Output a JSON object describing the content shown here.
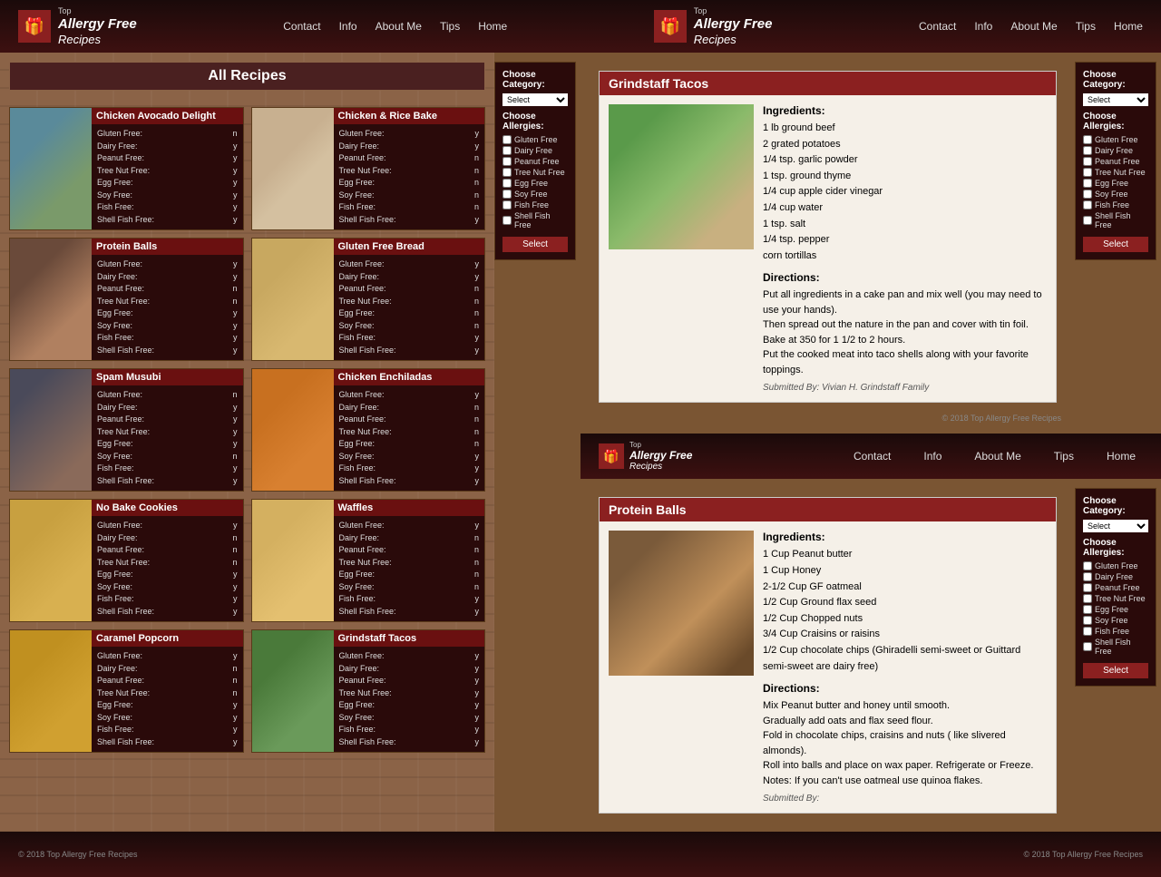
{
  "site": {
    "name_top": "Top",
    "name_main": "Allergy Free",
    "name_sub": "Recipes",
    "copyright": "© 2018 Top Allergy Free Recipes"
  },
  "nav": {
    "contact": "Contact",
    "info": "Info",
    "about": "About Me",
    "tips": "Tips",
    "home": "Home"
  },
  "left_panel": {
    "title": "All Recipes",
    "recipes": [
      {
        "name": "Chicken Avocado Delight",
        "img_class": "img-chicken-avocado",
        "allergies": [
          {
            "label": "Gluten Free:",
            "val": "n"
          },
          {
            "label": "Dairy Free:",
            "val": "y"
          },
          {
            "label": "Peanut Free:",
            "val": "y"
          },
          {
            "label": "Tree Nut Free:",
            "val": "y"
          },
          {
            "label": "Egg Free:",
            "val": "y"
          },
          {
            "label": "Soy Free:",
            "val": "y"
          },
          {
            "label": "Fish Free:",
            "val": "y"
          },
          {
            "label": "Shell Fish Free:",
            "val": "y"
          }
        ]
      },
      {
        "name": "Chicken & Rice Bake",
        "img_class": "img-chicken-rice",
        "allergies": [
          {
            "label": "Gluten Free:",
            "val": "y"
          },
          {
            "label": "Dairy Free:",
            "val": "y"
          },
          {
            "label": "Peanut Free:",
            "val": "n"
          },
          {
            "label": "Tree Nut Free:",
            "val": "n"
          },
          {
            "label": "Egg Free:",
            "val": "n"
          },
          {
            "label": "Soy Free:",
            "val": "n"
          },
          {
            "label": "Fish Free:",
            "val": "n"
          },
          {
            "label": "Shell Fish Free:",
            "val": "y"
          }
        ]
      },
      {
        "name": "Protein Balls",
        "img_class": "img-protein-balls",
        "allergies": [
          {
            "label": "Gluten Free:",
            "val": "y"
          },
          {
            "label": "Dairy Free:",
            "val": "y"
          },
          {
            "label": "Peanut Free:",
            "val": "n"
          },
          {
            "label": "Tree Nut Free:",
            "val": "n"
          },
          {
            "label": "Egg Free:",
            "val": "y"
          },
          {
            "label": "Soy Free:",
            "val": "y"
          },
          {
            "label": "Fish Free:",
            "val": "y"
          },
          {
            "label": "Shell Fish Free:",
            "val": "y"
          }
        ]
      },
      {
        "name": "Gluten Free Bread",
        "img_class": "img-gluten-bread",
        "allergies": [
          {
            "label": "Gluten Free:",
            "val": "y"
          },
          {
            "label": "Dairy Free:",
            "val": "y"
          },
          {
            "label": "Peanut Free:",
            "val": "n"
          },
          {
            "label": "Tree Nut Free:",
            "val": "n"
          },
          {
            "label": "Egg Free:",
            "val": "n"
          },
          {
            "label": "Soy Free:",
            "val": "n"
          },
          {
            "label": "Fish Free:",
            "val": "y"
          },
          {
            "label": "Shell Fish Free:",
            "val": "y"
          }
        ]
      },
      {
        "name": "Spam Musubi",
        "img_class": "img-spam",
        "allergies": [
          {
            "label": "Gluten Free:",
            "val": "n"
          },
          {
            "label": "Dairy Free:",
            "val": "y"
          },
          {
            "label": "Peanut Free:",
            "val": "y"
          },
          {
            "label": "Tree Nut Free:",
            "val": "y"
          },
          {
            "label": "Egg Free:",
            "val": "y"
          },
          {
            "label": "Soy Free:",
            "val": "n"
          },
          {
            "label": "Fish Free:",
            "val": "y"
          },
          {
            "label": "Shell Fish Free:",
            "val": "y"
          }
        ]
      },
      {
        "name": "Chicken Enchiladas",
        "img_class": "img-enchiladas",
        "allergies": [
          {
            "label": "Gluten Free:",
            "val": "y"
          },
          {
            "label": "Dairy Free:",
            "val": "n"
          },
          {
            "label": "Peanut Free:",
            "val": "n"
          },
          {
            "label": "Tree Nut Free:",
            "val": "n"
          },
          {
            "label": "Egg Free:",
            "val": "n"
          },
          {
            "label": "Soy Free:",
            "val": "y"
          },
          {
            "label": "Fish Free:",
            "val": "y"
          },
          {
            "label": "Shell Fish Free:",
            "val": "y"
          }
        ]
      },
      {
        "name": "No Bake Cookies",
        "img_class": "img-nobake",
        "allergies": [
          {
            "label": "Gluten Free:",
            "val": "y"
          },
          {
            "label": "Dairy Free:",
            "val": "n"
          },
          {
            "label": "Peanut Free:",
            "val": "n"
          },
          {
            "label": "Tree Nut Free:",
            "val": "n"
          },
          {
            "label": "Egg Free:",
            "val": "y"
          },
          {
            "label": "Soy Free:",
            "val": "y"
          },
          {
            "label": "Fish Free:",
            "val": "y"
          },
          {
            "label": "Shell Fish Free:",
            "val": "y"
          }
        ]
      },
      {
        "name": "Waffles",
        "img_class": "img-waffles",
        "allergies": [
          {
            "label": "Gluten Free:",
            "val": "y"
          },
          {
            "label": "Dairy Free:",
            "val": "n"
          },
          {
            "label": "Peanut Free:",
            "val": "n"
          },
          {
            "label": "Tree Nut Free:",
            "val": "n"
          },
          {
            "label": "Egg Free:",
            "val": "n"
          },
          {
            "label": "Soy Free:",
            "val": "n"
          },
          {
            "label": "Fish Free:",
            "val": "y"
          },
          {
            "label": "Shell Fish Free:",
            "val": "y"
          }
        ]
      },
      {
        "name": "Caramel Popcorn",
        "img_class": "img-caramel",
        "allergies": [
          {
            "label": "Gluten Free:",
            "val": "y"
          },
          {
            "label": "Dairy Free:",
            "val": "n"
          },
          {
            "label": "Peanut Free:",
            "val": "n"
          },
          {
            "label": "Tree Nut Free:",
            "val": "n"
          },
          {
            "label": "Egg Free:",
            "val": "y"
          },
          {
            "label": "Soy Free:",
            "val": "y"
          },
          {
            "label": "Fish Free:",
            "val": "y"
          },
          {
            "label": "Shell Fish Free:",
            "val": "y"
          }
        ]
      },
      {
        "name": "Grindstaff Tacos",
        "img_class": "img-grindstaff",
        "allergies": [
          {
            "label": "Gluten Free:",
            "val": "y"
          },
          {
            "label": "Dairy Free:",
            "val": "y"
          },
          {
            "label": "Peanut Free:",
            "val": "y"
          },
          {
            "label": "Tree Nut Free:",
            "val": "y"
          },
          {
            "label": "Egg Free:",
            "val": "y"
          },
          {
            "label": "Soy Free:",
            "val": "y"
          },
          {
            "label": "Fish Free:",
            "val": "y"
          },
          {
            "label": "Shell Fish Free:",
            "val": "y"
          }
        ]
      }
    ]
  },
  "filter": {
    "choose_category_label": "Choose Category:",
    "select_default": "Select",
    "choose_allergies_label": "Choose Allergies:",
    "allergies": [
      {
        "label": "Gluten Free"
      },
      {
        "label": "Dairy Free"
      },
      {
        "label": "Peanut Free"
      },
      {
        "label": "Tree Nut Free"
      },
      {
        "label": "Egg Free"
      },
      {
        "label": "Soy Free"
      },
      {
        "label": "Fish Free"
      },
      {
        "label": "Shell Fish Free"
      }
    ],
    "select_btn": "Select"
  },
  "grindstaff_tacos": {
    "title": "Grindstaff Tacos",
    "ingredients_title": "Ingredients:",
    "ingredients": [
      "1 lb ground beef",
      "2 grated potatoes",
      "1/4 tsp. garlic powder",
      "1 tsp. ground thyme",
      "1/4 cup apple cider vinegar",
      "1/4 cup water",
      "1 tsp. salt",
      "1/4 tsp. pepper",
      "corn tortillas"
    ],
    "directions_title": "Directions:",
    "directions": [
      "Put all ingredients in a cake pan and mix well (you may need to use your hands).",
      "Then spread out the nature in the pan and cover with tin foil.",
      "Bake at 350 for 1 1/2 to 2 hours.",
      "Put the cooked meat into taco shells along with your favorite toppings."
    ],
    "submitted_by": "Submitted By: Vivian H. Grindstaff Family"
  },
  "protein_balls": {
    "title": "Protein Balls",
    "ingredients_title": "Ingredients:",
    "ingredients": [
      "1 Cup Peanut butter",
      "1 Cup Honey",
      "2-1/2 Cup GF oatmeal",
      "1/2 Cup Ground flax seed",
      "1/2 Cup Chopped nuts",
      "3/4 Cup Craisins or raisins",
      "1/2 Cup chocolate chips (Ghiradelli semi-sweet or Guittard semi-sweet are dairy free)"
    ],
    "directions_title": "Directions:",
    "directions": [
      "Mix Peanut butter and honey until smooth.",
      "Gradually add oats and flax seed flour.",
      "Fold in chocolate chips, craisins and nuts ( like slivered almonds).",
      "Roll into balls and place on wax paper. Refrigerate or Freeze.",
      "Notes: If you can't use oatmeal use quinoa flakes."
    ],
    "submitted_by": "Submitted By:"
  }
}
